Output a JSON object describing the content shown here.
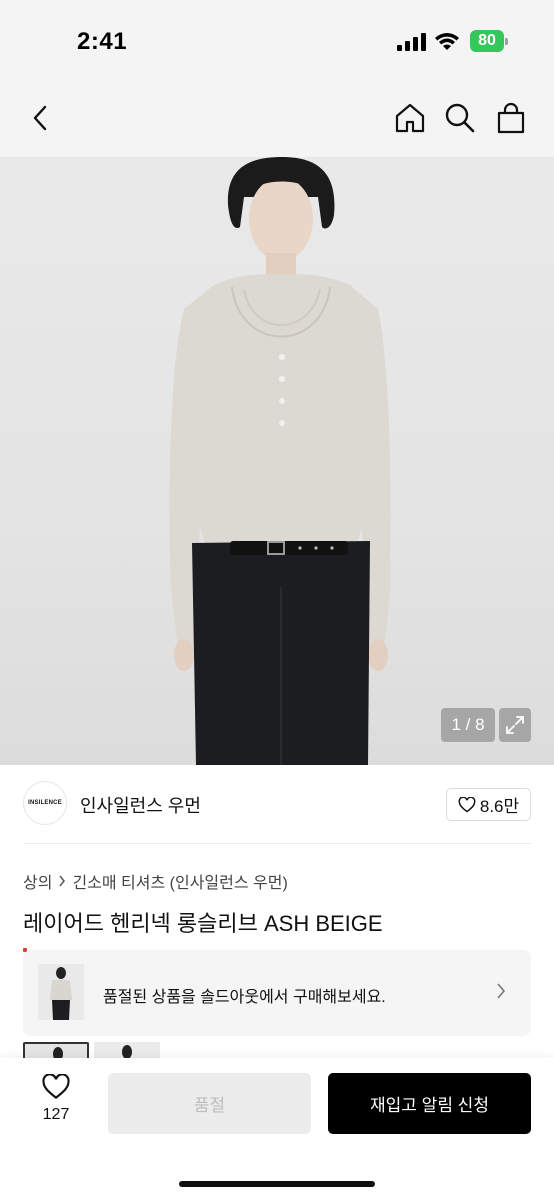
{
  "status_bar": {
    "time": "2:41",
    "battery": "80"
  },
  "nav": {
    "back_icon": "chevron-left-icon",
    "home_icon": "home-icon",
    "search_icon": "search-icon",
    "cart_icon": "shopping-bag-icon"
  },
  "gallery": {
    "pager": "1 / 8",
    "expand_icon": "expand-icon"
  },
  "brand": {
    "logo_text": "INSILENCE",
    "name": "인사일런스 우먼",
    "likes": "8.6만"
  },
  "breadcrumb": {
    "category": "상의",
    "subcategory": "긴소매 티셔츠 (인사일런스 우먼)"
  },
  "product": {
    "title": "레이어드 헨리넥 롱슬리브 ASH BEIGE"
  },
  "soldout_banner": {
    "text": "품절된 상품을 솔드아웃에서 구매해보세요."
  },
  "action_bar": {
    "wish_count": "127",
    "soldout_label": "품절",
    "restock_label": "재입고 알림 신청"
  },
  "colors": {
    "accent": "#000000",
    "battery": "#34c759",
    "disabled_bg": "#ececec"
  }
}
